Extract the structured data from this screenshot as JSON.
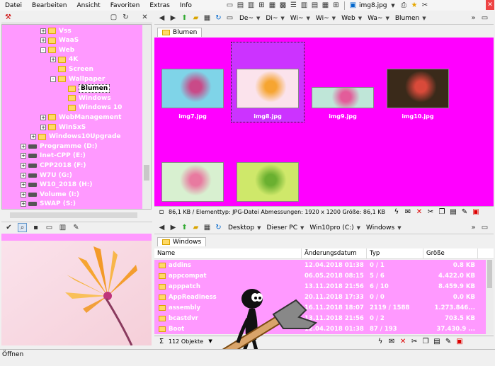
{
  "menu": [
    "Datei",
    "Bearbeiten",
    "Ansicht",
    "Favoriten",
    "Extras",
    "Info"
  ],
  "top_right": {
    "file_label": "img8.jpg"
  },
  "tree": {
    "items": [
      {
        "label": "Vss",
        "indent": 4,
        "type": "folder",
        "exp": "+"
      },
      {
        "label": "WaaS",
        "indent": 4,
        "type": "folder",
        "exp": "+"
      },
      {
        "label": "Web",
        "indent": 4,
        "type": "folder",
        "exp": "-"
      },
      {
        "label": "4K",
        "indent": 5,
        "type": "folder",
        "exp": "+"
      },
      {
        "label": "Screen",
        "indent": 5,
        "type": "folder",
        "exp": ""
      },
      {
        "label": "Wallpaper",
        "indent": 5,
        "type": "folder",
        "exp": "-"
      },
      {
        "label": "Blumen",
        "indent": 6,
        "type": "folder",
        "exp": "",
        "selected": true
      },
      {
        "label": "Windows",
        "indent": 6,
        "type": "folder",
        "exp": ""
      },
      {
        "label": "Windows 10",
        "indent": 6,
        "type": "folder",
        "exp": ""
      },
      {
        "label": "WebManagement",
        "indent": 4,
        "type": "folder",
        "exp": "+"
      },
      {
        "label": "WinSxS",
        "indent": 4,
        "type": "folder",
        "exp": "+"
      },
      {
        "label": "Windows10Upgrade",
        "indent": 3,
        "type": "folder",
        "exp": "+"
      },
      {
        "label": "Programme (D:)",
        "indent": 2,
        "type": "drive",
        "exp": "+"
      },
      {
        "label": "Inet-CPP (E:)",
        "indent": 2,
        "type": "drive",
        "exp": "+"
      },
      {
        "label": "CPP2018 (F:)",
        "indent": 2,
        "type": "drive",
        "exp": "+"
      },
      {
        "label": "W7U (G:)",
        "indent": 2,
        "type": "drive",
        "exp": "+"
      },
      {
        "label": "W10_2018 (H:)",
        "indent": 2,
        "type": "drive",
        "exp": "+"
      },
      {
        "label": "Volume (I:)",
        "indent": 2,
        "type": "drive",
        "exp": "+"
      },
      {
        "label": "SWAP (S:)",
        "indent": 2,
        "type": "drive",
        "exp": "+"
      }
    ]
  },
  "top_pane": {
    "crumbs": [
      "De~",
      "Di~",
      "Wi~",
      "Wi~",
      "Web",
      "Wa~",
      "Blumen"
    ],
    "tab": "Blumen",
    "thumbs": [
      {
        "name": "img7.jpg"
      },
      {
        "name": "img8.jpg",
        "selected": true
      },
      {
        "name": "img9.jpg"
      },
      {
        "name": "img10.jpg"
      },
      {
        "name": ""
      },
      {
        "name": ""
      }
    ],
    "status": "86,1 KB / Elementtyp: JPG-Datei Abmessungen: 1920 x 1200 Größe: 86,1 KB"
  },
  "bottom_pane": {
    "crumbs": [
      "Desktop",
      "Dieser PC",
      "Win10pro (C:)",
      "Windows"
    ],
    "tab": "Windows",
    "columns": [
      "Name",
      "Änderungsdatum",
      "Typ",
      "Größe"
    ],
    "rows": [
      {
        "name": "addins",
        "date": "12.04.2018 01:38",
        "type": "0 / 1",
        "size": "0.8 KB"
      },
      {
        "name": "appcompat",
        "date": "06.05.2018 08:15",
        "type": "5 / 6",
        "size": "4.422.0 KB"
      },
      {
        "name": "apppatch",
        "date": "13.11.2018 21:56",
        "type": "6 / 10",
        "size": "8.459.9 KB"
      },
      {
        "name": "AppReadiness",
        "date": "20.11.2018 17:33",
        "type": "0 / 0",
        "size": "0.0 KB"
      },
      {
        "name": "assembly",
        "date": "16.11.2018 18:07",
        "type": "2119 / 1588",
        "size": "1.273.846..."
      },
      {
        "name": "bcastdvr",
        "date": "13.11.2018 21:56",
        "type": "0 / 2",
        "size": "703.5 KB"
      },
      {
        "name": "Boot",
        "date": "12.04.2018 01:38",
        "type": "87 / 193",
        "size": "37.430.9 ..."
      }
    ],
    "status": "112 Objekte"
  },
  "bottom_status": "Öffnen"
}
